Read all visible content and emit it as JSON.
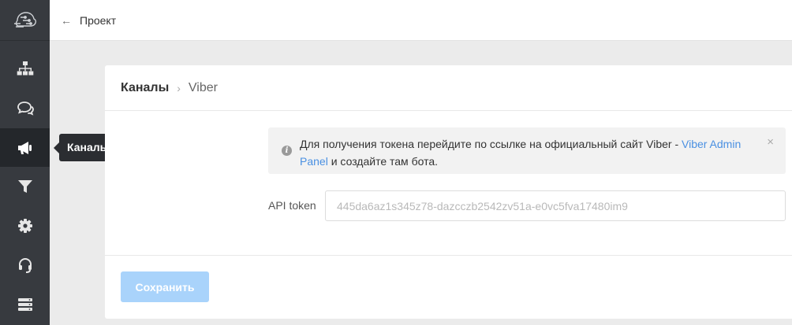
{
  "topbar": {
    "back_icon": "arrow-left-icon",
    "back_label": "Проект"
  },
  "sidebar": {
    "logo_icon": "brain-circuit-logo",
    "items": [
      {
        "id": "structure",
        "icon": "sitemap-icon"
      },
      {
        "id": "chats",
        "icon": "chat-bubbles-icon"
      },
      {
        "id": "channels",
        "icon": "megaphone-icon",
        "active": true
      },
      {
        "id": "filters",
        "icon": "filter-icon"
      },
      {
        "id": "settings",
        "icon": "gear-icon"
      },
      {
        "id": "support",
        "icon": "headset-icon"
      },
      {
        "id": "storage",
        "icon": "server-icon"
      }
    ]
  },
  "tooltip": {
    "label": "Каналы"
  },
  "breadcrumb": {
    "parent": "Каналы",
    "separator": "›",
    "current": "Viber"
  },
  "alert": {
    "text_before": "Для получения токена перейдите по ссылке на официальный сайт Viber - ",
    "link_text": "Viber Admin Panel",
    "text_after": " и создайте там бота.",
    "close": "×"
  },
  "api_token": {
    "label": "API token",
    "placeholder": "445da6az1s345z78-dazcczb2542zv51a-e0vc5fva17480im9",
    "value": ""
  },
  "actions": {
    "save_label": "Сохранить"
  },
  "colors": {
    "sidebar": "#373a3f",
    "accent": "#4a90e2",
    "save_disabled": "#a9d3fb"
  }
}
